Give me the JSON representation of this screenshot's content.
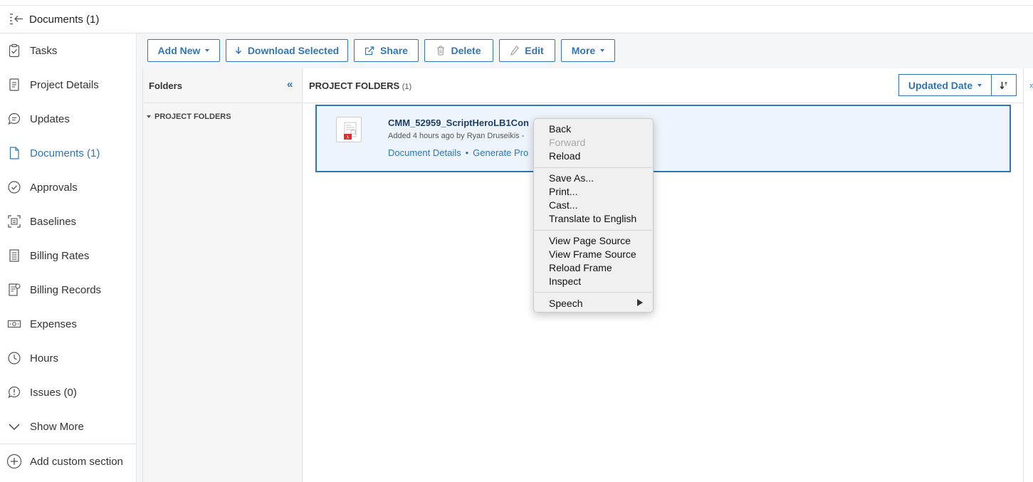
{
  "header": {
    "title": "Documents (1)"
  },
  "sidebar": {
    "items": [
      {
        "label": "Tasks",
        "icon": "clipboard-check-icon"
      },
      {
        "label": "Project Details",
        "icon": "document-lines-icon"
      },
      {
        "label": "Updates",
        "icon": "chat-bubble-icon"
      },
      {
        "label": "Documents (1)",
        "icon": "document-icon",
        "active": true
      },
      {
        "label": "Approvals",
        "icon": "check-circle-icon"
      },
      {
        "label": "Baselines",
        "icon": "baseline-icon"
      },
      {
        "label": "Billing Rates",
        "icon": "billing-list-icon"
      },
      {
        "label": "Billing Records",
        "icon": "billing-records-icon"
      },
      {
        "label": "Expenses",
        "icon": "money-icon"
      },
      {
        "label": "Hours",
        "icon": "clock-icon"
      },
      {
        "label": "Issues (0)",
        "icon": "issue-bubble-icon"
      },
      {
        "label": "Show More",
        "icon": "chevron-down-icon"
      },
      {
        "label": "Add custom section",
        "icon": "plus-circle-icon"
      }
    ]
  },
  "toolbar": {
    "add_new": "Add New",
    "download_selected": "Download Selected",
    "share": "Share",
    "delete": "Delete",
    "edit": "Edit",
    "more": "More"
  },
  "folders_panel": {
    "title": "Folders",
    "collapse": "«",
    "tree_root": "PROJECT FOLDERS"
  },
  "main": {
    "title": "PROJECT FOLDERS",
    "count": "(1)",
    "sort_label": "Updated Date",
    "close": "»"
  },
  "document": {
    "name": "CMM_52959_ScriptHeroLB1Con",
    "meta": "Added 4 hours ago by Ryan Druseikis -",
    "link_details": "Document Details",
    "link_separator": "•",
    "link_generate": "Generate Pro"
  },
  "context_menu": {
    "items": [
      {
        "label": "Back",
        "enabled": true
      },
      {
        "label": "Forward",
        "enabled": false
      },
      {
        "label": "Reload",
        "enabled": true
      },
      {
        "label": "Save As...",
        "enabled": true
      },
      {
        "label": "Print...",
        "enabled": true
      },
      {
        "label": "Cast...",
        "enabled": true
      },
      {
        "label": "Translate to English",
        "enabled": true
      },
      {
        "label": "View Page Source",
        "enabled": true
      },
      {
        "label": "View Frame Source",
        "enabled": true
      },
      {
        "label": "Reload Frame",
        "enabled": true
      },
      {
        "label": "Inspect",
        "enabled": true
      },
      {
        "label": "Speech",
        "enabled": true,
        "submenu": true
      }
    ]
  },
  "colors": {
    "accent": "#2f76b6",
    "selected_bg": "#eef4fb",
    "doc_title": "#1f3f66"
  }
}
